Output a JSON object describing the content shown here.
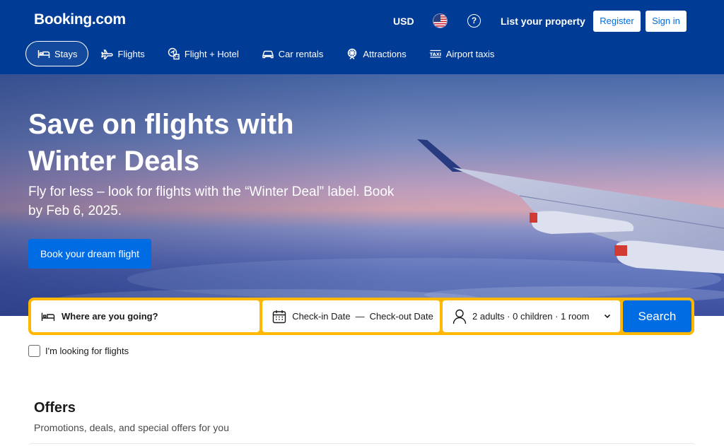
{
  "header": {
    "logo": "Booking.com",
    "currency": "USD",
    "flag_icon": "us-flag-icon",
    "help_icon": "question-mark-icon",
    "help_glyph": "?",
    "list_property": "List your property",
    "register": "Register",
    "sign_in": "Sign in",
    "background": "#003b95"
  },
  "nav": {
    "items": [
      {
        "label": "Stays",
        "icon": "bed-icon",
        "active": true
      },
      {
        "label": "Flights",
        "icon": "plane-icon"
      },
      {
        "label": "Flight + Hotel",
        "icon": "flight-hotel-icon"
      },
      {
        "label": "Car rentals",
        "icon": "car-icon"
      },
      {
        "label": "Attractions",
        "icon": "attractions-icon"
      },
      {
        "label": "Airport taxis",
        "icon": "taxi-icon"
      }
    ]
  },
  "hero": {
    "title": "Save on flights with Winter Deals",
    "subtitle": "Fly for less – look for flights with the “Winter Deal” label. Book by Feb 6, 2025.",
    "cta": "Book your dream flight"
  },
  "search": {
    "destination_placeholder": "Where are you going?",
    "check_in": "Check-in Date",
    "dash": "—",
    "check_out": "Check-out Date",
    "guests": "2 adults · 0 children · 1 room",
    "button": "Search",
    "frame_color": "#ffb700",
    "accent": "#006ce4"
  },
  "flights_checkbox": {
    "label": "I'm looking for flights",
    "checked": false
  },
  "offers": {
    "title": "Offers",
    "subtitle": "Promotions, deals, and special offers for you"
  }
}
